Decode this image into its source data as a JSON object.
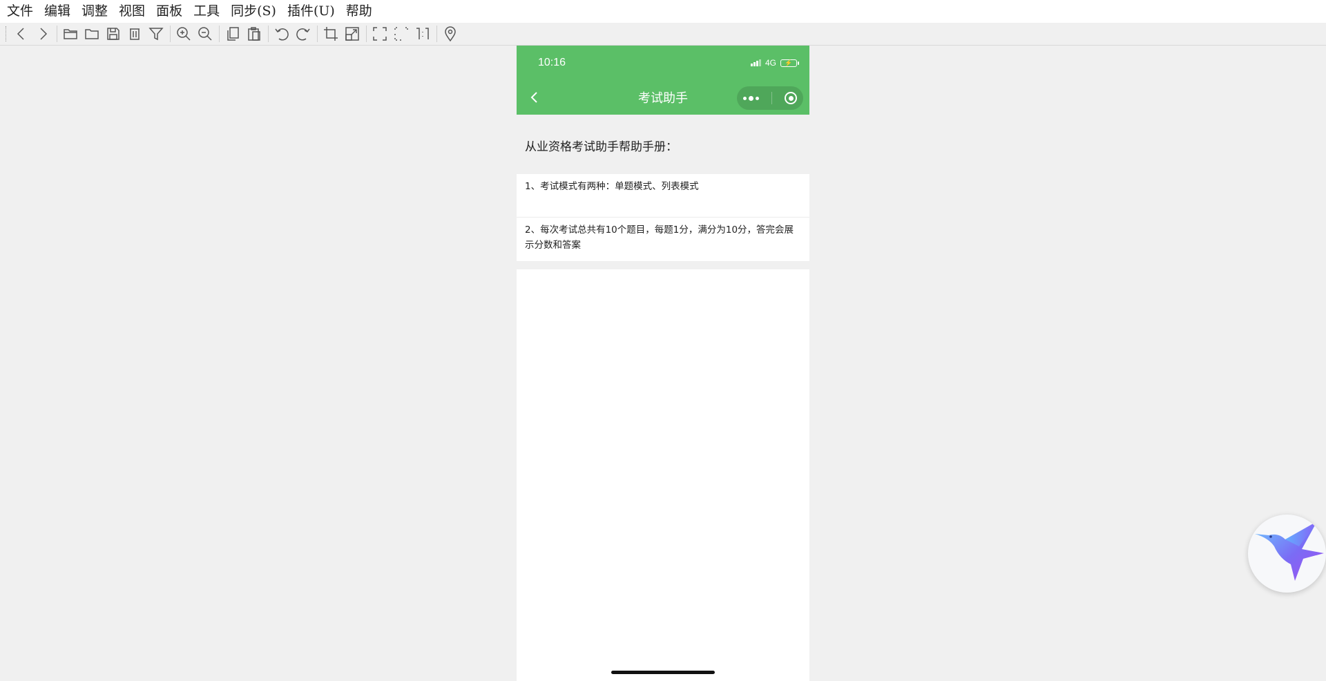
{
  "menubar": {
    "items": [
      "文件",
      "编辑",
      "调整",
      "视图",
      "面板",
      "工具",
      "同步(S)",
      "插件(U)",
      "帮助"
    ]
  },
  "toolbar": {
    "icons": [
      "back-icon",
      "forward-icon",
      "open-folder-icon",
      "folder-icon",
      "save-icon",
      "delete-icon",
      "filter-icon",
      "zoom-in-icon",
      "zoom-out-icon",
      "copy-icon",
      "paste-icon",
      "rotate-left-icon",
      "rotate-right-icon",
      "crop-icon",
      "resize-icon",
      "fullscreen-icon",
      "fit-icon",
      "actual-size-icon",
      "location-pin-icon"
    ]
  },
  "phone": {
    "status": {
      "time": "10:16",
      "network": "4G"
    },
    "nav": {
      "title": "考试助手"
    },
    "heading": "从业资格考试助手帮助手册：",
    "items": [
      "1、考试模式有两种：单题模式、列表模式",
      "2、每次考试总共有10个题目，每题1分，满分为10分，答完会展示分数和答案"
    ]
  },
  "colors": {
    "accent": "#5bbf67",
    "background": "#f0f0f0"
  }
}
